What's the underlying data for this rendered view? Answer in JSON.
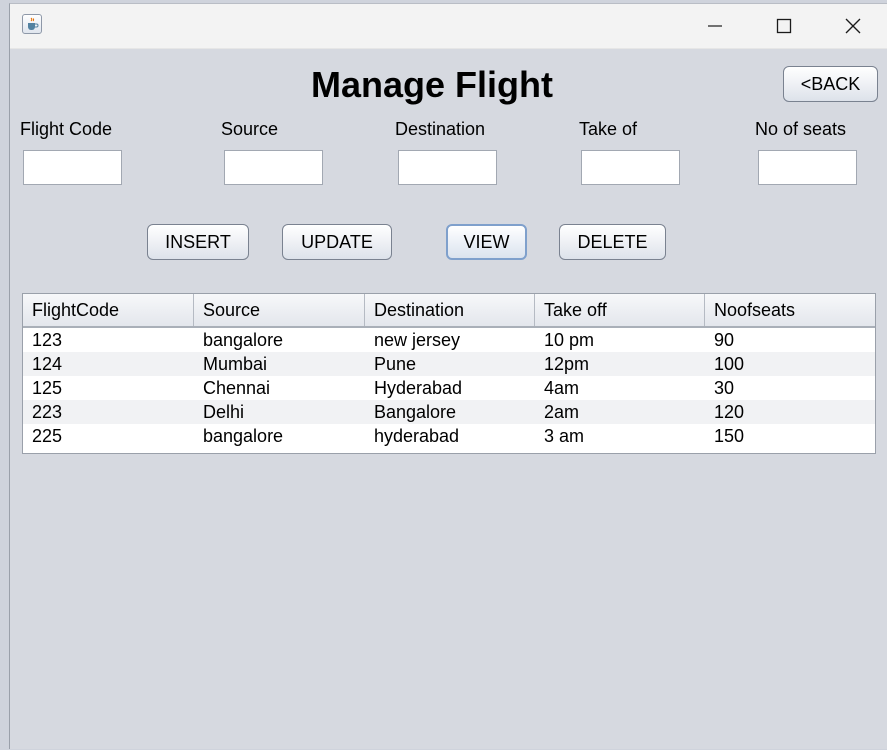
{
  "window": {
    "title_icon": "java-cup-icon",
    "controls": [
      "minimize",
      "maximize",
      "close"
    ]
  },
  "page": {
    "title": "Manage Flight",
    "back_label": "<BACK"
  },
  "form": {
    "fields": [
      {
        "label": "Flight Code",
        "value": ""
      },
      {
        "label": "Source",
        "value": ""
      },
      {
        "label": "Destination",
        "value": ""
      },
      {
        "label": "Take of",
        "value": ""
      },
      {
        "label": "No of seats",
        "value": ""
      }
    ]
  },
  "actions": {
    "insert_label": "INSERT",
    "update_label": "UPDATE",
    "view_label": "VIEW",
    "delete_label": "DELETE"
  },
  "table": {
    "columns": [
      "FlightCode",
      "Source",
      "Destination",
      "Take off",
      "Noofseats"
    ],
    "rows": [
      [
        "123",
        "bangalore",
        "new jersey",
        "10 pm",
        "90"
      ],
      [
        "124",
        "Mumbai",
        "Pune",
        "12pm",
        "100"
      ],
      [
        "125",
        "Chennai",
        "Hyderabad",
        "4am",
        "30"
      ],
      [
        "223",
        "Delhi",
        "Bangalore",
        "2am",
        "120"
      ],
      [
        "225",
        "bangalore",
        "hyderabad",
        "3 am",
        "150"
      ]
    ]
  },
  "colors": {
    "background": "#d6d9e0",
    "titlebar": "#f3f3f3",
    "focus_border": "#7fa0cc"
  }
}
